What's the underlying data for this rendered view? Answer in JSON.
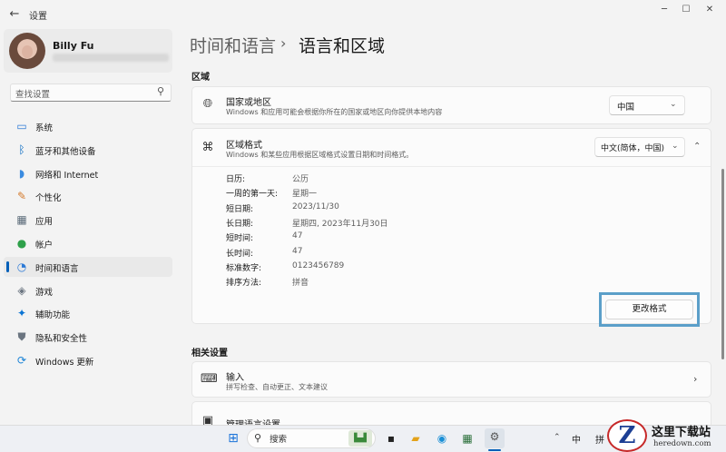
{
  "window": {
    "title": "设置",
    "controls": [
      "minimize",
      "maximize",
      "close"
    ]
  },
  "profile": {
    "name": "Billy Fu"
  },
  "search": {
    "placeholder": "查找设置"
  },
  "nav": {
    "items": [
      {
        "label": "系统",
        "icon": "system-icon",
        "color": "#2b79d6",
        "active": false
      },
      {
        "label": "蓝牙和其他设备",
        "icon": "bluetooth-icon",
        "color": "#0067c0",
        "active": false
      },
      {
        "label": "网络和 Internet",
        "icon": "wifi-icon",
        "color": "#3a8be0",
        "active": false
      },
      {
        "label": "个性化",
        "icon": "brush-icon",
        "color": "#d47a2c",
        "active": false
      },
      {
        "label": "应用",
        "icon": "apps-icon",
        "color": "#5c6c7a",
        "active": false
      },
      {
        "label": "帐户",
        "icon": "account-icon",
        "color": "#2ea04a",
        "active": false
      },
      {
        "label": "时间和语言",
        "icon": "time-language-icon",
        "color": "#2b79d6",
        "active": true
      },
      {
        "label": "游戏",
        "icon": "gaming-icon",
        "color": "#6b7580",
        "active": false
      },
      {
        "label": "辅助功能",
        "icon": "accessibility-icon",
        "color": "#0a74d4",
        "active": false
      },
      {
        "label": "隐私和安全性",
        "icon": "shield-icon",
        "color": "#6b7580",
        "active": false
      },
      {
        "label": "Windows 更新",
        "icon": "windows-update-icon",
        "color": "#1c84d6",
        "active": false
      }
    ]
  },
  "breadcrumb": {
    "parent": "时间和语言",
    "separator": "›",
    "current": "语言和区域"
  },
  "region": {
    "section_title": "区域",
    "country": {
      "title": "国家或地区",
      "subtitle": "Windows 和应用可能会根据你所在的国家或地区向你提供本地内容",
      "value": "中国"
    },
    "format": {
      "title": "区域格式",
      "subtitle": "Windows 和某些应用根据区域格式设置日期和时间格式。",
      "value": "中文(简体，中国)",
      "expanded": true,
      "rows": [
        {
          "label": "日历:",
          "value": "公历"
        },
        {
          "label": "一周的第一天:",
          "value": "星期一"
        },
        {
          "label": "短日期:",
          "value": "2023/11/30"
        },
        {
          "label": "长日期:",
          "value": "星期四, 2023年11月30日"
        },
        {
          "label": "短时间:",
          "value": "47"
        },
        {
          "label": "长时间:",
          "value": "47"
        },
        {
          "label": "标准数字:",
          "value": "0123456789"
        },
        {
          "label": "排序方法:",
          "value": "拼音"
        }
      ],
      "change_button": "更改格式"
    }
  },
  "related": {
    "section_title": "相关设置",
    "input": {
      "title": "输入",
      "subtitle": "拼写检查、自动更正、文本建议"
    },
    "language_pack": {
      "title": "管理语言设置"
    }
  },
  "taskbar": {
    "search_text": "搜索",
    "tray_ime_mode": "中",
    "tray_ime": "拼"
  },
  "watermark": {
    "logo_letter": "Z",
    "title": "这里下载站",
    "subtitle": "heredown.com"
  },
  "colors": {
    "accent": "#005fb8",
    "highlight_box": "#5b9fc9"
  }
}
